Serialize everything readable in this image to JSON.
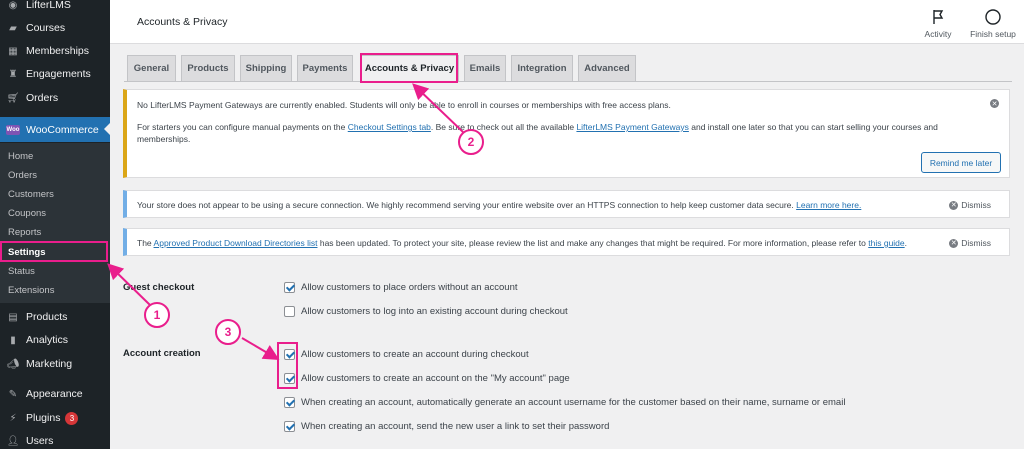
{
  "sidebar": {
    "top_items": [
      {
        "label": "LifterLMS",
        "icon": "lifterlms-icon"
      },
      {
        "label": "Courses",
        "icon": "courses-icon"
      },
      {
        "label": "Memberships",
        "icon": "memberships-icon"
      },
      {
        "label": "Engagements",
        "icon": "engagements-icon"
      },
      {
        "label": "Orders",
        "icon": "orders-icon"
      }
    ],
    "woo_label": "WooCommerce",
    "woo_icon_text": "Woo",
    "submenu": [
      "Home",
      "Orders",
      "Customers",
      "Coupons",
      "Reports",
      "Settings",
      "Status",
      "Extensions"
    ],
    "bottom_items": [
      {
        "label": "Products",
        "icon": "products-icon"
      },
      {
        "label": "Analytics",
        "icon": "analytics-icon"
      },
      {
        "label": "Marketing",
        "icon": "marketing-icon"
      },
      {
        "label": "Appearance",
        "icon": "appearance-icon"
      },
      {
        "label": "Plugins",
        "icon": "plugins-icon",
        "badge": "3"
      },
      {
        "label": "Users",
        "icon": "users-icon"
      }
    ]
  },
  "header": {
    "title": "Accounts & Privacy",
    "activity_label": "Activity",
    "finish_label": "Finish setup"
  },
  "tabs": [
    "General",
    "Products",
    "Shipping",
    "Payments",
    "Accounts & Privacy",
    "Emails",
    "Integration",
    "Advanced"
  ],
  "active_tab": "Accounts & Privacy",
  "notices": {
    "gateway": {
      "line1": "No LifterLMS Payment Gateways are currently enabled. Students will only be able to enroll in courses or memberships with free access plans.",
      "line2_pre": "For starters you can configure manual payments on the ",
      "line2_link1": "Checkout Settings tab",
      "line2_mid": ". Be sure to check out all the available ",
      "line2_link2": "LifterLMS Payment Gateways",
      "line2_post": " and install one later so that you can start selling your courses and",
      "line3": "memberships.",
      "remind_label": "Remind me later"
    },
    "ssl": {
      "text": "Your store does not appear to be using a secure connection. We highly recommend serving your entire website over an HTTPS connection to help keep customer data secure. ",
      "link": "Learn more here.",
      "dismiss": "Dismiss"
    },
    "dirs": {
      "pre": "The ",
      "link1": "Approved Product Download Directories list",
      "mid": " has been updated. To protect your site, please review the list and make any changes that might be required. For more information, please refer to ",
      "link2": "this guide",
      "post": ".",
      "dismiss": "Dismiss"
    }
  },
  "settings": {
    "guest_checkout": {
      "label": "Guest checkout",
      "options": [
        {
          "text": "Allow customers to place orders without an account",
          "checked": true
        },
        {
          "text": "Allow customers to log into an existing account during checkout",
          "checked": false
        }
      ]
    },
    "account_creation": {
      "label": "Account creation",
      "options": [
        {
          "text": "Allow customers to create an account during checkout",
          "checked": true
        },
        {
          "text": "Allow customers to create an account on the \"My account\" page",
          "checked": true
        },
        {
          "text": "When creating an account, automatically generate an account username for the customer based on their name, surname or email",
          "checked": true
        },
        {
          "text": "When creating an account, send the new user a link to set their password",
          "checked": true
        }
      ]
    }
  },
  "annotations": [
    "1",
    "2",
    "3"
  ],
  "colors": {
    "sidebar_bg": "#1d2327",
    "accent": "#2271b1",
    "annotation": "#e91e8c",
    "warning": "#dba617"
  }
}
